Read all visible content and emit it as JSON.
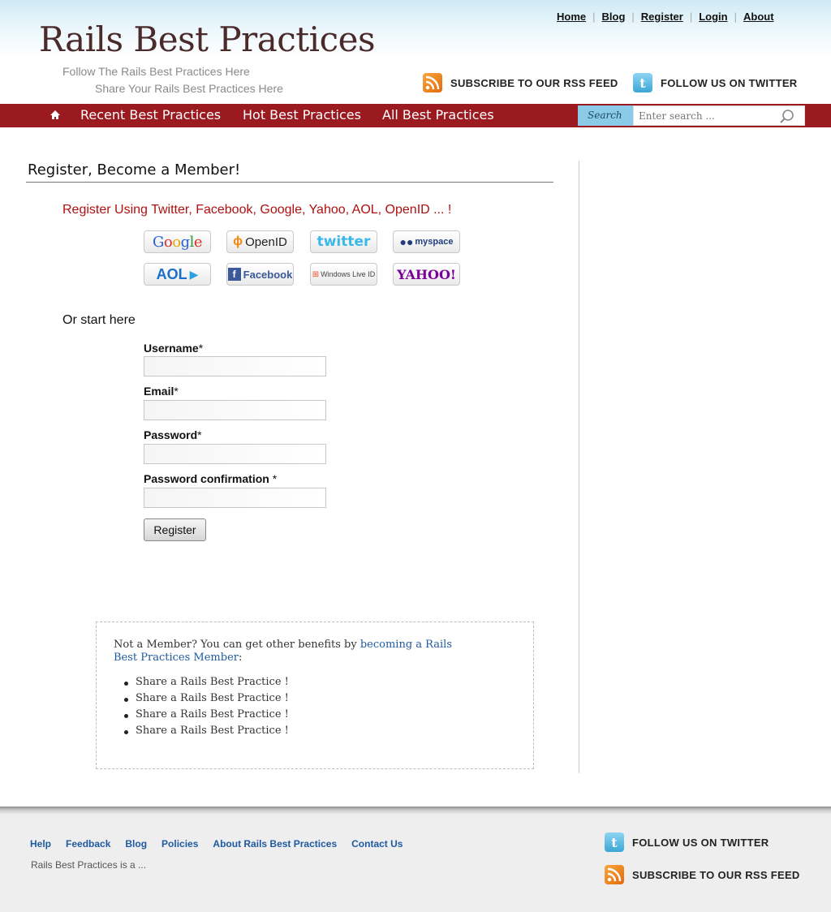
{
  "header": {
    "site_title": "Rails Best Practices",
    "tagline_1": "Follow The Rails Best Practices Here",
    "tagline_2": "Share Your Rails Best Practices Here",
    "top_nav": [
      "Home",
      "Blog",
      "Register",
      "Login",
      "About"
    ],
    "rss_label": "SUBSCRIBE TO OUR RSS FEED",
    "twitter_label": "FOLLOW US ON TWITTER"
  },
  "navbar": {
    "items": [
      "Recent Best Practices",
      "Hot Best Practices",
      "All Best Practices"
    ],
    "search_label": "Search",
    "search_placeholder": "Enter search ..."
  },
  "main": {
    "heading": "Register, Become a Member!",
    "register_using": "Register Using Twitter, Facebook, Google, Yahoo, AOL, OpenID ...  !",
    "providers": [
      "Google",
      "OpenID",
      "twitter",
      "myspace",
      "AOL",
      "Facebook",
      "Windows Live ID",
      "YAHOO!"
    ],
    "or_start": "Or start here",
    "fields": {
      "username": "Username",
      "email": "Email",
      "password": "Password",
      "password_confirmation": "Password confirmation",
      "required_mark": "*",
      "required_mark_spaced": " *"
    },
    "register_button": "Register"
  },
  "member_box": {
    "intro": "Not a Member? You can get other benefits by ",
    "link": "becoming a Rails Best Practices Member",
    "colon": ":",
    "benefits": [
      "Share a Rails Best Practice !",
      "Share a Rails Best Practice !",
      "Share a Rails Best Practice !",
      "Share a Rails Best Practice !"
    ]
  },
  "footer": {
    "links": [
      "Help",
      "Feedback",
      "Blog",
      "Policies",
      "About Rails Best Practices",
      "Contact Us"
    ],
    "about": "Rails Best Practices is a ...",
    "twitter_label": "FOLLOW US ON TWITTER",
    "rss_label": "SUBSCRIBE TO OUR RSS FEED"
  },
  "colors": {
    "navbar": "#9a1a20",
    "register_using": "#b01010",
    "link": "#1f5aa0",
    "search_label_bg": "#8ccbe8"
  }
}
